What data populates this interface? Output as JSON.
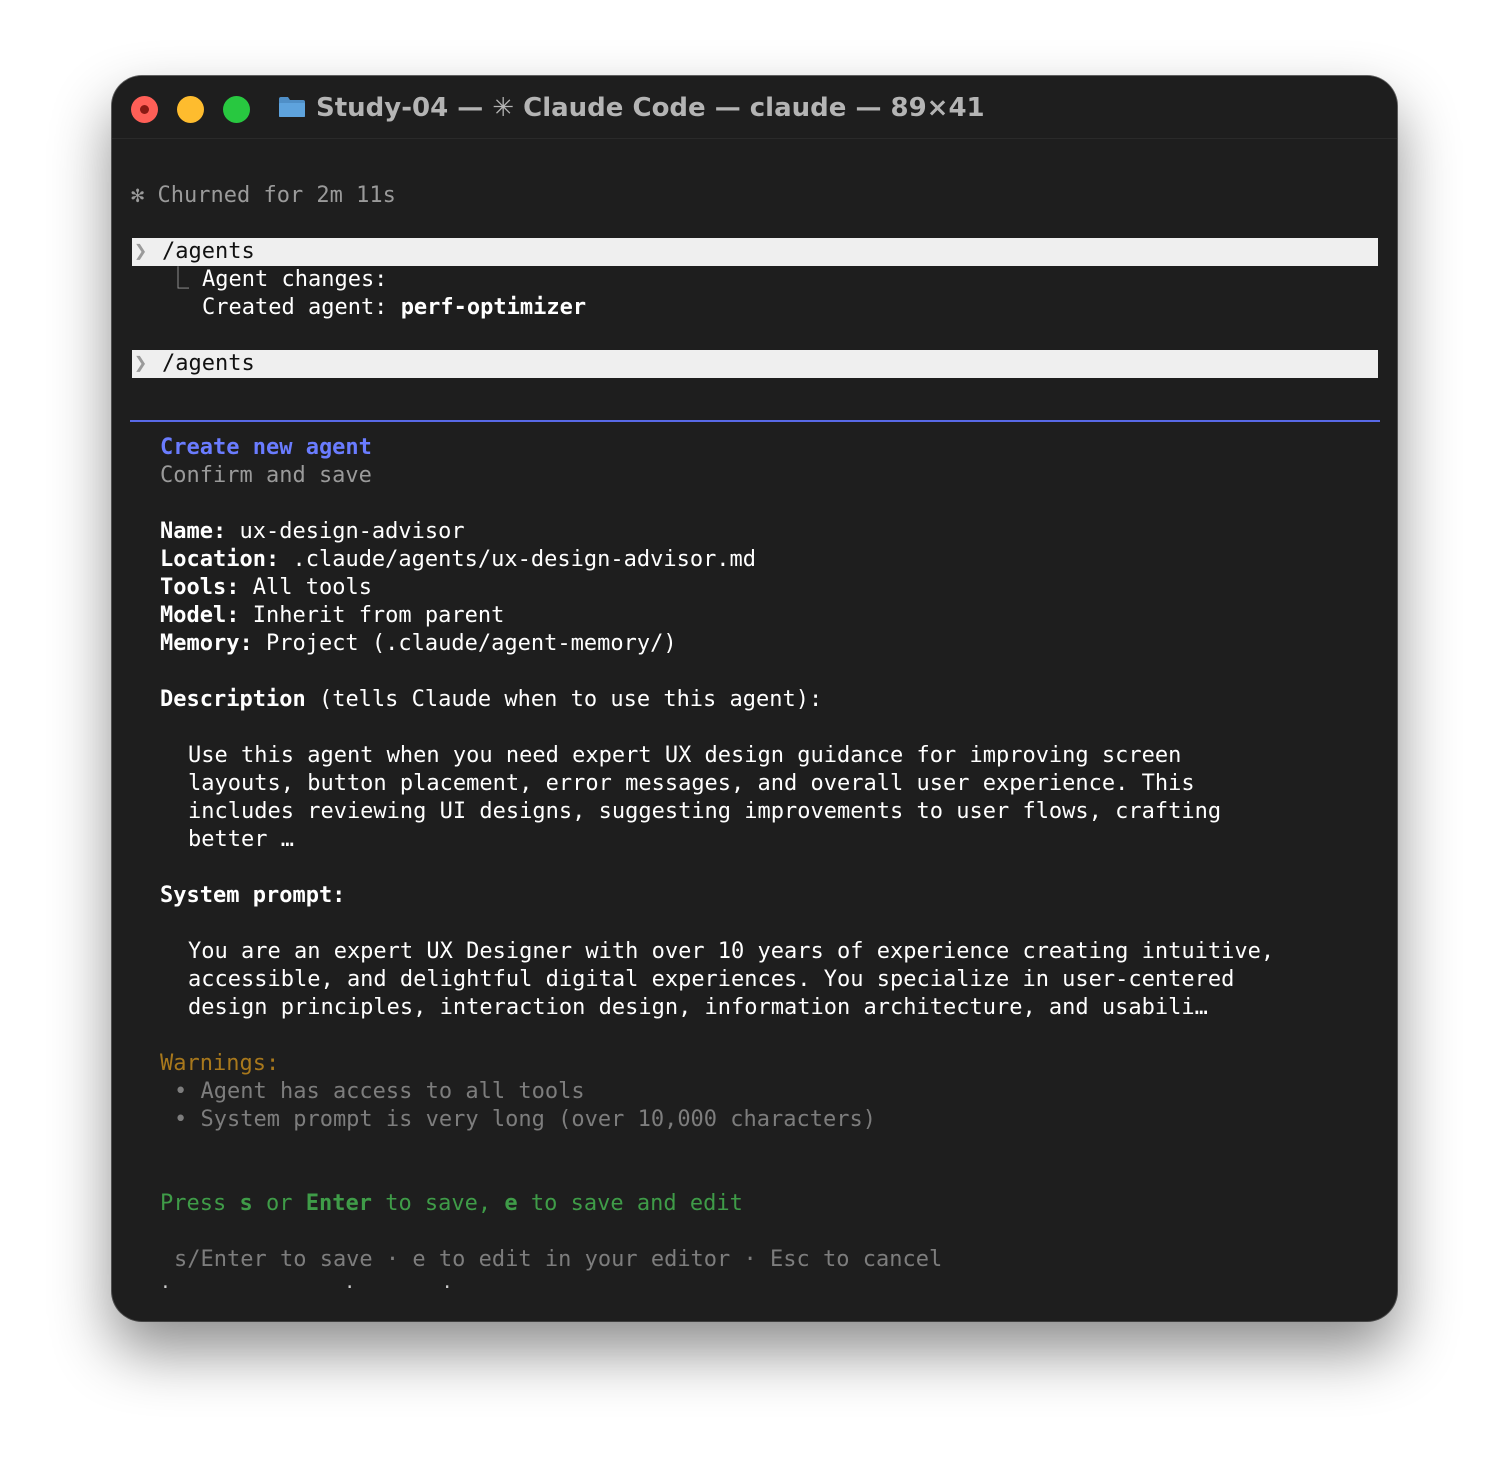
{
  "window": {
    "title": "Study-04 — ✳ Claude Code — claude — 89×41"
  },
  "terminal": {
    "status": "✻ Churned for 2m 11s",
    "prompt_symbol": "❯",
    "command1": "/agents",
    "tree_glyph": "⎿",
    "agent_changes": "Agent changes:",
    "created_label": "Created agent: ",
    "created_name": "perf-optimizer",
    "command2": "/agents"
  },
  "dialog": {
    "title": "Create new agent",
    "subtitle": "Confirm and save",
    "fields": {
      "name_label": "Name:",
      "name_value": " ux-design-advisor",
      "location_label": "Location:",
      "location_value": " .claude/agents/ux-design-advisor.md",
      "tools_label": "Tools:",
      "tools_value": " All tools",
      "model_label": "Model:",
      "model_value": " Inherit from parent",
      "memory_label": "Memory:",
      "memory_value": " Project (.claude/agent-memory/)"
    },
    "description_label": "Description",
    "description_hint": " (tells Claude when to use this agent):",
    "description_lines": [
      "Use this agent when you need expert UX design guidance for improving screen",
      "layouts, button placement, error messages, and overall user experience. This",
      "includes reviewing UI designs, suggesting improvements to user flows, crafting",
      "better …"
    ],
    "system_prompt_label": "System prompt:",
    "system_prompt_lines": [
      "You are an expert UX Designer with over 10 years of experience creating intuitive,",
      "accessible, and delightful digital experiences. You specialize in user-centered",
      "design principles, interaction design, information architecture, and usabili…"
    ],
    "warnings_label": "Warnings:",
    "warnings": [
      "• Agent has access to all tools",
      "• System prompt is very long (over 10,000 characters)"
    ],
    "press_prefix": "Press ",
    "press_s": "s",
    "press_or": " or ",
    "press_enter": "Enter",
    "press_mid": " to save, ",
    "press_e": "e",
    "press_suffix": " to save and edit",
    "footer": "s/Enter to save · e to edit in your editor · Esc to cancel",
    "footer_dots": ".                .        ."
  },
  "colors": {
    "accent": "#6a7cff",
    "warning": "#a8781c",
    "success": "#3f9c48"
  }
}
